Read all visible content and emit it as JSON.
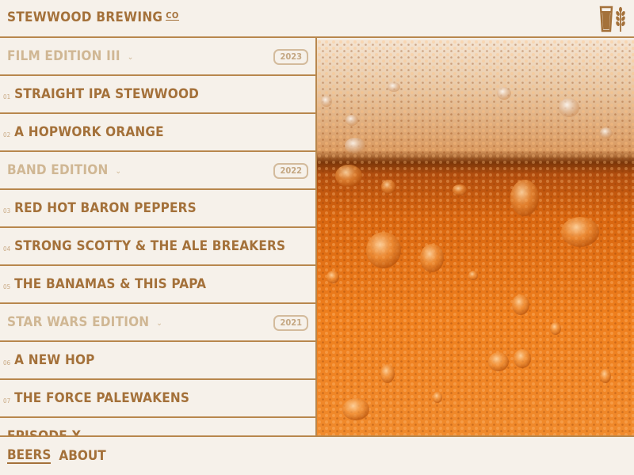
{
  "brand": {
    "name": "STEWWOOD BREWING",
    "suffix": "CO"
  },
  "list": [
    {
      "kind": "section",
      "title": "FILM EDITION III",
      "year": "2023"
    },
    {
      "kind": "item",
      "num": "01",
      "title": "STRAIGHT IPA STEWWOOD"
    },
    {
      "kind": "item",
      "num": "02",
      "title": "A HOPWORK ORANGE"
    },
    {
      "kind": "section",
      "title": "BAND EDITION",
      "year": "2022"
    },
    {
      "kind": "item",
      "num": "03",
      "title": "RED HOT BARON PEPPERS"
    },
    {
      "kind": "item",
      "num": "04",
      "title": "STRONG SCOTTY & THE ALE BREAKERS"
    },
    {
      "kind": "item",
      "num": "05",
      "title": "THE BANAMAS & THIS PAPA"
    },
    {
      "kind": "section",
      "title": "STAR WARS EDITION",
      "year": "2021"
    },
    {
      "kind": "item",
      "num": "06",
      "title": "A NEW HOP"
    },
    {
      "kind": "item",
      "num": "07",
      "title": "THE FORCE PALEWAKENS"
    },
    {
      "kind": "item",
      "num": "",
      "title": "EPISODE X"
    }
  ],
  "nav": {
    "beers": "BEERS",
    "about": "ABOUT"
  },
  "icons": {
    "logo": "beer-glass-wheat-icon",
    "section_chevron": "chevron-down-icon"
  },
  "colors": {
    "accent": "#a4713a",
    "background": "#f6f1ea",
    "muted": "#d3bb9c",
    "beer": "#e9761c"
  }
}
